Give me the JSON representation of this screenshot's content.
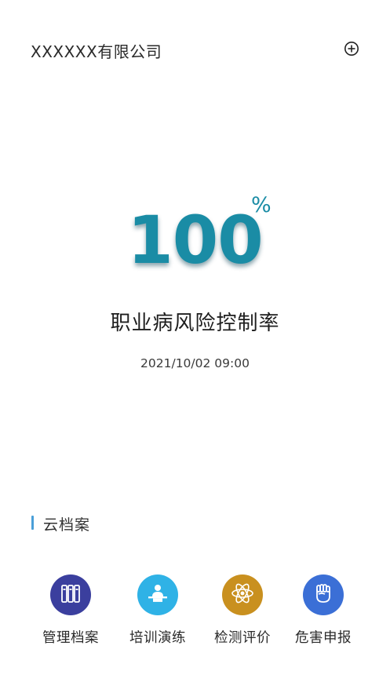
{
  "header": {
    "company_name": "XXXXXX有限公司",
    "add_icon": "circle-plus-icon"
  },
  "stat": {
    "value": "100",
    "unit": "%",
    "label": "职业病风险控制率",
    "timestamp": "2021/10/02 09:00",
    "color": "#1a8ca5"
  },
  "section": {
    "title": "云档案",
    "accent_color": "#4a9fd8"
  },
  "grid": [
    {
      "label": "管理档案",
      "icon": "binders-icon",
      "color": "#3b3f9e"
    },
    {
      "label": "培训演练",
      "icon": "lecture-icon",
      "color": "#2fb2e6"
    },
    {
      "label": "检测评价",
      "icon": "atom-icon",
      "color": "#c9901f"
    },
    {
      "label": "危害申报",
      "icon": "fist-icon",
      "color": "#3b6fd6"
    }
  ]
}
